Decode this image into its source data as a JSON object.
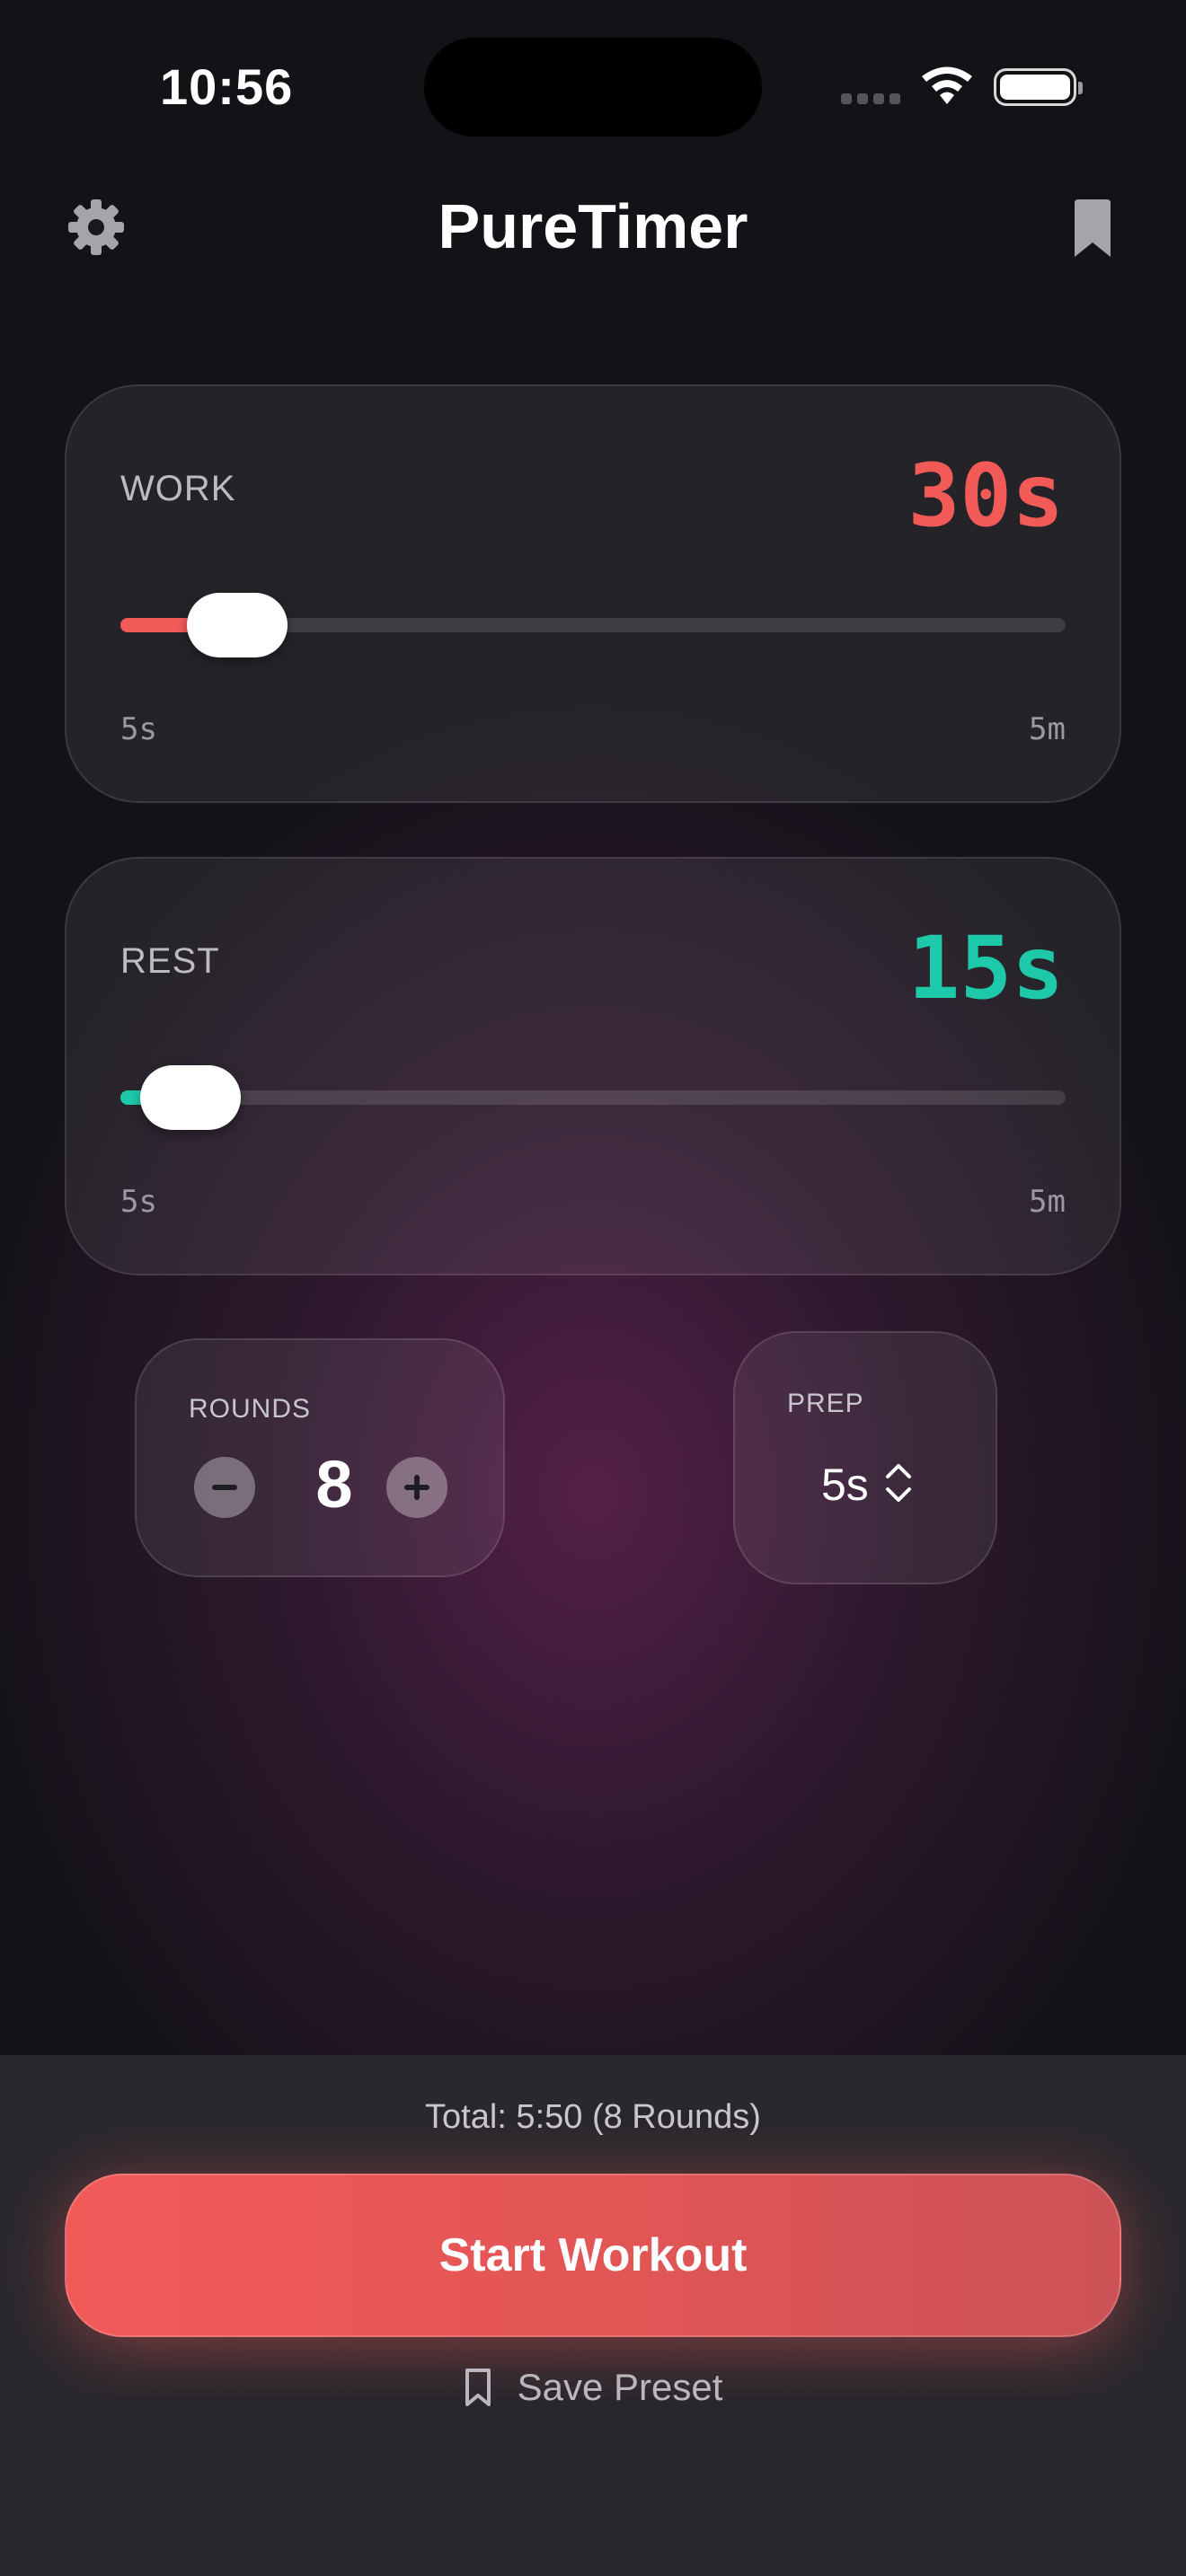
{
  "status_bar": {
    "time": "10:56"
  },
  "header": {
    "title": "PureTimer",
    "settings_icon": "gear-icon",
    "presets_icon": "bookmark-icon"
  },
  "work": {
    "label": "WORK",
    "value": "30s",
    "min": "5s",
    "max": "5m",
    "level": 0.08,
    "accent": "#f25a58"
  },
  "rest": {
    "label": "REST",
    "value": "15s",
    "min": "5s",
    "max": "5m",
    "level": 0.03,
    "accent": "#1ec9aa"
  },
  "rounds": {
    "label": "ROUNDS",
    "value": "8"
  },
  "prep": {
    "label": "PREP",
    "value": "5s"
  },
  "footer": {
    "total": "Total: 5:50 (8 Rounds)",
    "start_label": "Start Workout",
    "save_label": "Save Preset",
    "accent": "#f25a58"
  }
}
